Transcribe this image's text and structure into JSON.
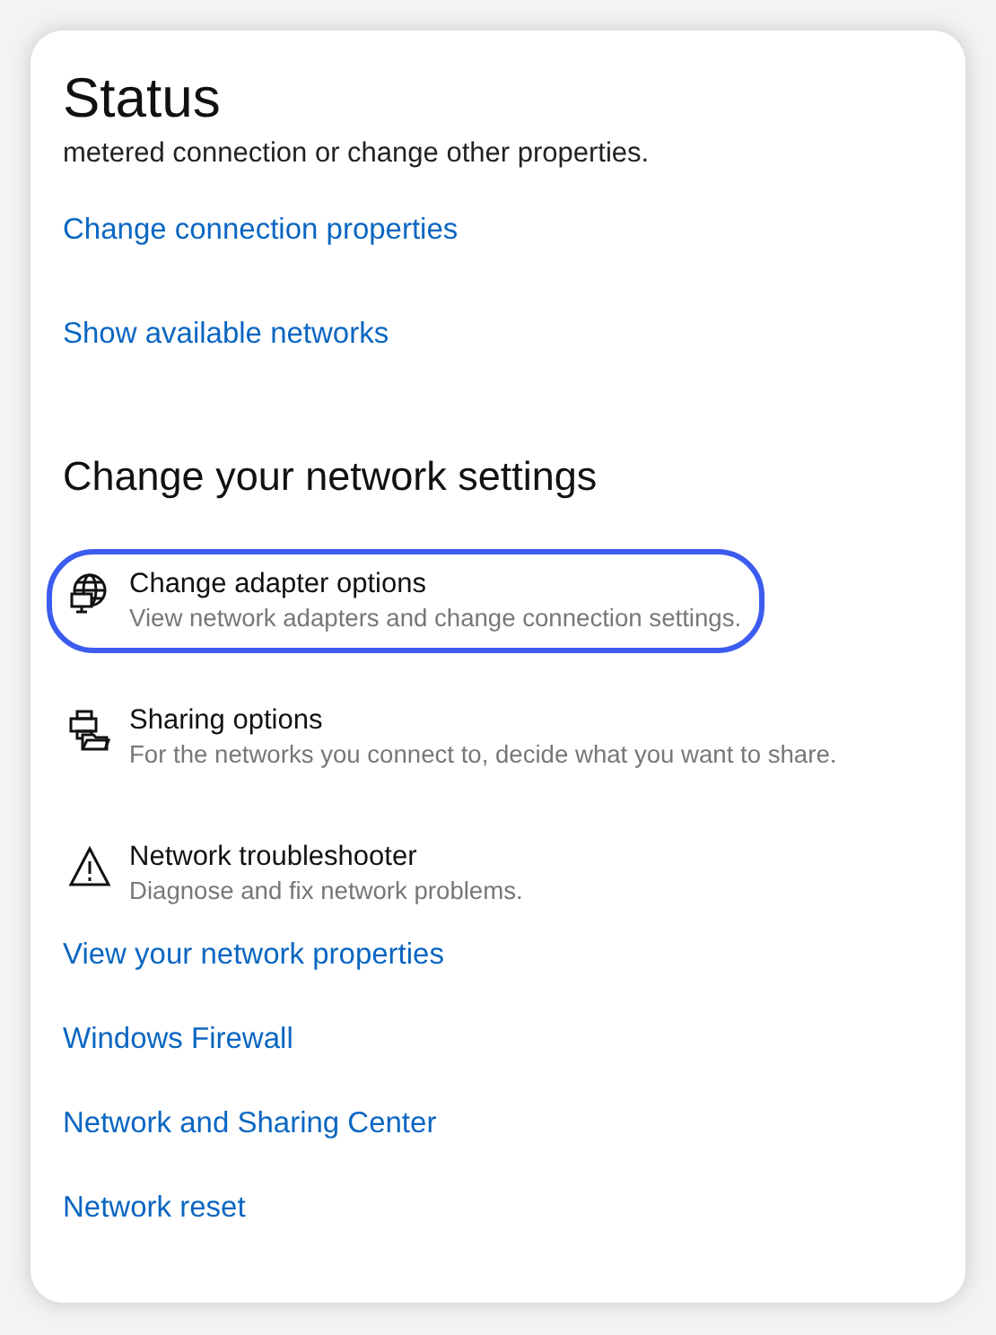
{
  "page": {
    "title": "Status",
    "intro": "metered connection or change other properties."
  },
  "top_links": [
    {
      "label": "Change connection properties"
    },
    {
      "label": "Show available networks"
    }
  ],
  "section": {
    "heading": "Change your network settings"
  },
  "options": [
    {
      "kind": "adapter",
      "title": "Change adapter options",
      "description": "View network adapters and change connection settings.",
      "highlighted": true
    },
    {
      "kind": "sharing",
      "title": "Sharing options",
      "description": "For the networks you connect to, decide what you want to share.",
      "highlighted": false
    },
    {
      "kind": "troubleshooter",
      "title": "Network troubleshooter",
      "description": "Diagnose and fix network problems.",
      "highlighted": false
    }
  ],
  "bottom_links": [
    {
      "label": "View your network properties"
    },
    {
      "label": "Windows Firewall"
    },
    {
      "label": "Network and Sharing Center"
    },
    {
      "label": "Network reset"
    }
  ]
}
